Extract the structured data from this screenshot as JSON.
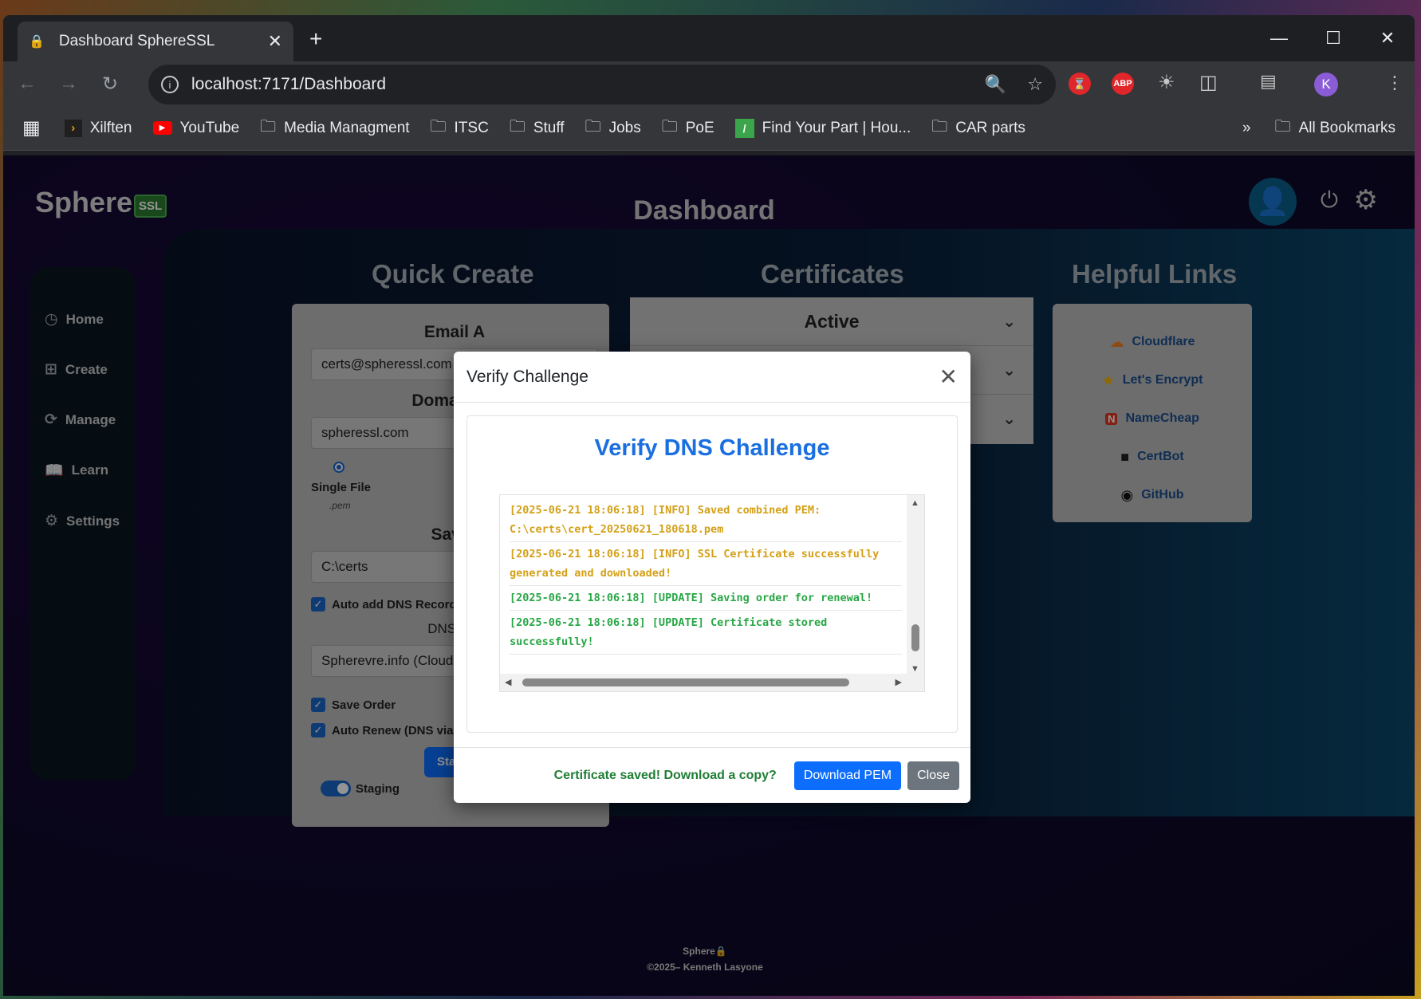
{
  "browser": {
    "tab_title": "Dashboard SphereSSL",
    "url": "localhost:7171/Dashboard",
    "profile_initial": "K",
    "bookmarks": [
      {
        "label": "Xilften",
        "icon": "plex-icon"
      },
      {
        "label": "YouTube",
        "icon": "youtube-icon"
      },
      {
        "label": "Media Managment",
        "icon": "folder-icon"
      },
      {
        "label": "ITSC",
        "icon": "folder-icon"
      },
      {
        "label": "Stuff",
        "icon": "folder-icon"
      },
      {
        "label": "Jobs",
        "icon": "folder-icon"
      },
      {
        "label": "PoE",
        "icon": "folder-icon"
      },
      {
        "label": "Find Your Part | Hou...",
        "icon": "fyp-icon"
      },
      {
        "label": "CAR parts",
        "icon": "folder-icon"
      }
    ],
    "all_bookmarks": "All Bookmarks"
  },
  "app": {
    "brand": "Sphere",
    "brand_badge": "SSL",
    "page_title": "Dashboard",
    "sidebar": [
      {
        "label": "Home",
        "icon": "dashboard-icon"
      },
      {
        "label": "Create",
        "icon": "plus-square-icon"
      },
      {
        "label": "Manage",
        "icon": "refresh-icon"
      },
      {
        "label": "Learn",
        "icon": "book-icon"
      },
      {
        "label": "Settings",
        "icon": "gear-icon"
      }
    ],
    "quick_create": {
      "title": "Quick Create",
      "email_label": "Email A",
      "email_value": "certs@spheressl.com",
      "domain_label": "Domain A",
      "domain_value": "spheressl.com",
      "single_file_label": "Single File",
      "single_file_ext": ".pem",
      "save_label": "Save",
      "save_value": "C:\\certs",
      "auto_dns_label": "Auto add DNS Record",
      "dns_provider_label": "DNS Pr",
      "dns_provider_value": "Spherevre.info (Cloudfl",
      "save_order_label": "Save Order",
      "auto_renew_label": "Auto Renew (DNS via A",
      "start_button": "Sta",
      "staging_label": "Staging"
    },
    "certificates": {
      "title": "Certificates",
      "rows": [
        "Active",
        "",
        ""
      ]
    },
    "helpful_links": {
      "title": "Helpful Links",
      "links": [
        {
          "label": "Cloudflare",
          "icon": "cloud-icon"
        },
        {
          "label": "Let's Encrypt",
          "icon": "letsencrypt-icon"
        },
        {
          "label": "NameCheap",
          "icon": "namecheap-icon"
        },
        {
          "label": "CertBot",
          "icon": "certbot-icon"
        },
        {
          "label": "GitHub",
          "icon": "github-icon"
        }
      ]
    },
    "footer": {
      "brand": "Sphere",
      "copyright": "©2025– Kenneth Lasyone"
    }
  },
  "modal": {
    "title": "Verify Challenge",
    "heading": "Verify DNS Challenge",
    "log": [
      {
        "level": "info",
        "text": "[2025-06-21 18:06:18] [INFO] Saved combined PEM: C:\\certs\\cert_20250621_180618.pem"
      },
      {
        "level": "info",
        "text": "[2025-06-21 18:06:18] [INFO] SSL Certificate successfully generated and downloaded!"
      },
      {
        "level": "update",
        "text": "[2025-06-21 18:06:18] [UPDATE] Saving order for renewal!"
      },
      {
        "level": "update",
        "text": "[2025-06-21 18:06:18] [UPDATE] Certificate stored successfully!"
      }
    ],
    "footer_message": "Certificate saved! Download a copy?",
    "download_button": "Download PEM",
    "close_button": "Close",
    "colors": {
      "info": "#d4a017",
      "update": "#28a745",
      "heading": "#1a6fe0"
    }
  }
}
